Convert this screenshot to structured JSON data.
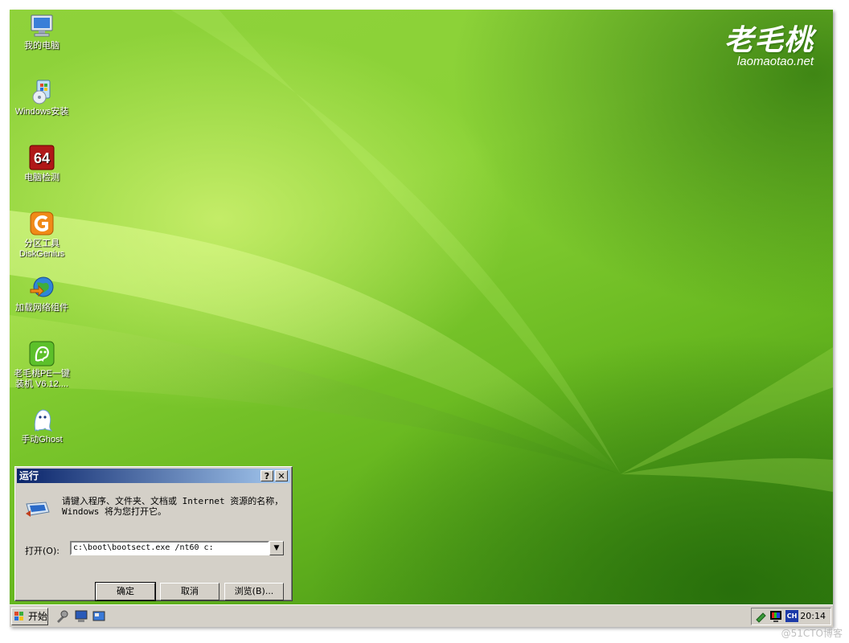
{
  "desktop": {
    "brand": {
      "logo_text": "老毛桃",
      "site": "laomaotao.net"
    },
    "icons": [
      {
        "label": "我的电脑",
        "icon": "my-computer-icon"
      },
      {
        "label": "Windows安装",
        "icon": "windows-install-icon"
      },
      {
        "label": "电脑检测",
        "icon": "aida64-icon"
      },
      {
        "label": "分区工具\nDiskGenius",
        "icon": "diskgenius-icon"
      },
      {
        "label": "加载网络组件",
        "icon": "network-globe-icon"
      },
      {
        "label": "老毛桃PE一键\n装机 V6.12....",
        "icon": "laomaotao-installer-icon"
      },
      {
        "label": "手动Ghost",
        "icon": "ghost-icon"
      }
    ]
  },
  "run_dialog": {
    "title": "运行",
    "help_btn": "?",
    "close_btn": "✕",
    "description": "请键入程序、文件夹、文档或 Internet 资源的名称，Windows 将为您打开它。",
    "open_label": "打开(O):",
    "input_value": "c:\\boot\\bootsect.exe /nt60 c:",
    "dropdown_glyph": "▼",
    "buttons": {
      "ok": "确定",
      "cancel": "取消",
      "browse": "浏览(B)..."
    }
  },
  "taskbar": {
    "start_label": "开始",
    "lang": "CH",
    "clock": "20:14"
  },
  "watermark": "@51CTO博客",
  "colors": {
    "title_bar_start": "#0a246a",
    "title_bar_end": "#a6caf0",
    "dialog_face": "#d4d0c8",
    "desktop_green": "#8ad236"
  }
}
